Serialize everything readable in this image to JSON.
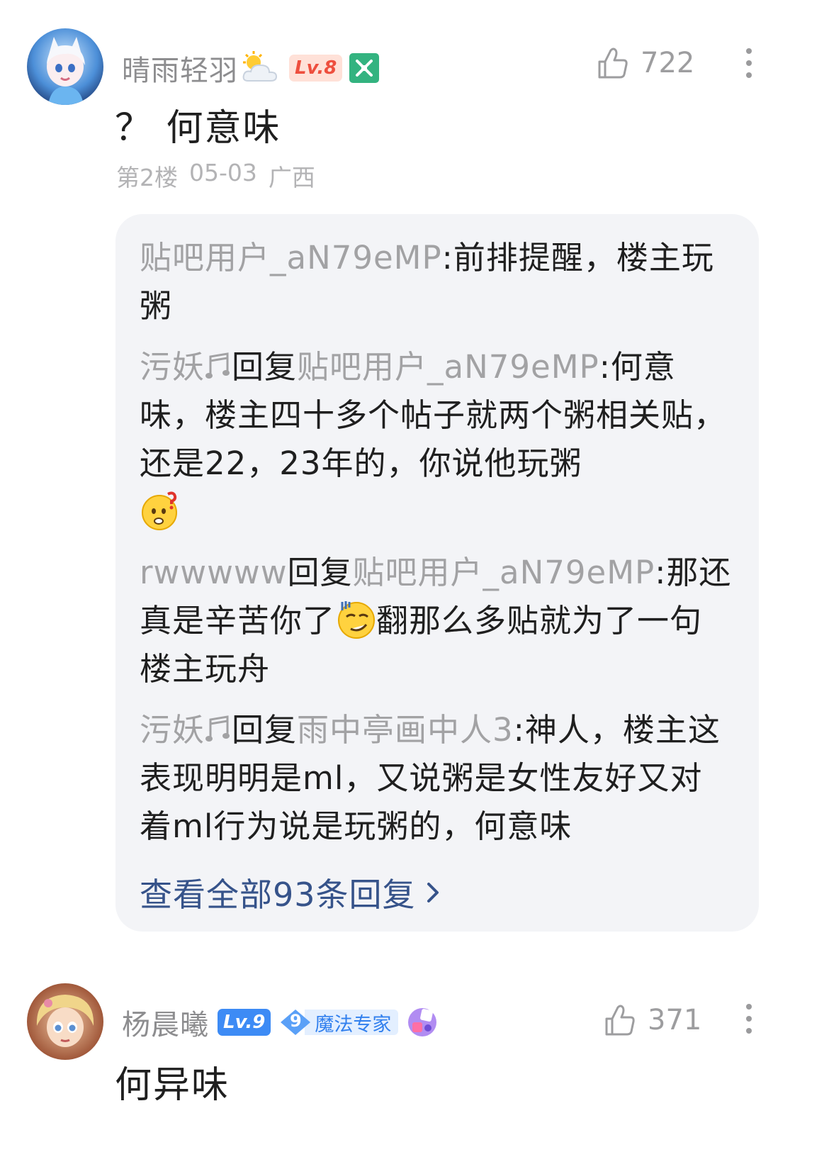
{
  "comments": [
    {
      "username": "晴雨轻羽",
      "level_badge": "Lv.8",
      "likes": "722",
      "text": "？ 何意味",
      "floor": "第2楼",
      "date": "05-03",
      "location": "广西",
      "replies": [
        {
          "author": "贴吧用户_aN79eMP",
          "colon": ":",
          "text": "前排提醒，楼主玩粥"
        },
        {
          "author": "污妖",
          "reply_word": "回复",
          "target": "贴吧用户_aN79eMP",
          "colon": ":",
          "text": "何意味，楼主四十多个帖子就两个粥相关贴，还是22，23年的，你说他玩粥",
          "emoji": "confused-face-emoji"
        },
        {
          "author": "rwwwww",
          "reply_word": "回复",
          "target": "贴吧用户_aN79eMP",
          "colon": ":",
          "text_before": "那还真是辛苦你了",
          "emoji": "sweat-smirk-emoji",
          "text_after": "翻那么多贴就为了一句楼主玩舟"
        },
        {
          "author": "污妖",
          "reply_word": "回复",
          "target": "雨中亭画中人3",
          "colon": ":",
          "text": "神人，楼主这表现明明是ml，又说粥是女性友好又对着ml行为说是玩粥的，何意味"
        }
      ],
      "view_all_label": "查看全部93条回复"
    },
    {
      "username": "杨晨曦",
      "level_badge": "Lv.9",
      "expert_level": "9",
      "expert_title": "魔法专家",
      "likes": "371",
      "text": "何异味"
    }
  ],
  "colors": {
    "username_gray": "#8d8d8f",
    "link_blue": "#36538a",
    "reply_bg": "#f3f4f7",
    "lv8_text": "#ee4f3e",
    "lv9_bg": "#3d8bf5"
  }
}
